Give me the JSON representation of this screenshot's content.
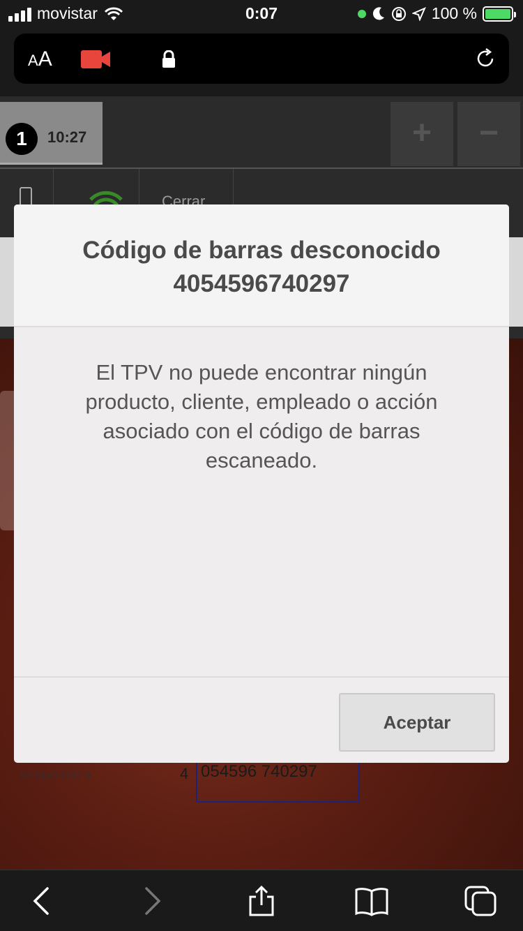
{
  "status_bar": {
    "carrier": "movistar",
    "time": "0:07",
    "battery": "100 %",
    "battery_level": 1.0
  },
  "url_bar": {
    "text_size_label_small": "A",
    "text_size_label_large": "A"
  },
  "order": {
    "number": "1",
    "time": "10:27"
  },
  "toolbar": {
    "plus": "+",
    "minus": "−",
    "close_label": "Cerrar"
  },
  "camera": {
    "barcode_prefix": "4",
    "barcode_text": "054596 740297",
    "small_code": "DY-8140-0567-9"
  },
  "modal": {
    "title_line1": "Código de barras desconocido",
    "title_line2": "4054596740297",
    "message": "El TPV no puede encontrar ningún producto, cliente, empleado o acción asociado con el código de barras escaneado.",
    "accept_label": "Aceptar"
  },
  "colors": {
    "modal_bg": "#efeded",
    "camera_bg": "#5a1d12",
    "status_green": "#4cd964",
    "recording_red": "#e8453c"
  }
}
